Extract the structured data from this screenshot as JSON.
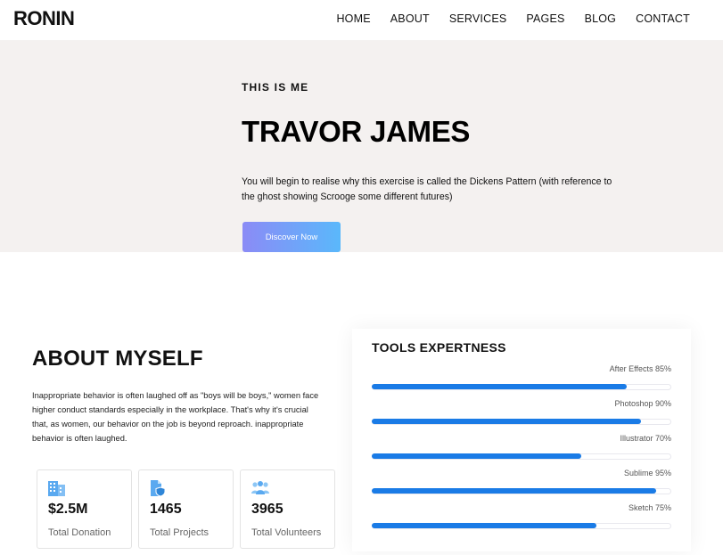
{
  "header": {
    "logo": "RONIN",
    "menu": [
      "HOME",
      "ABOUT",
      "SERVICES",
      "PAGES",
      "BLOG",
      "CONTACT"
    ]
  },
  "hero": {
    "kicker": "THIS IS ME",
    "title": "TRAVOR JAMES",
    "description": "You will begin to realise why this exercise is called the Dickens Pattern (with reference to the ghost showing Scrooge some different futures)",
    "button_label": "Discover Now"
  },
  "about": {
    "title": "ABOUT MYSELF",
    "text": "Inappropriate behavior is often laughed off as \"boys will be boys,\" women face higher conduct standards especially in the workplace. That's why it's crucial that, as women, our behavior on the job is beyond reproach. inappropriate behavior is often laughed.",
    "stats": [
      {
        "icon": "building-icon",
        "value": "$2.5M",
        "label": "Total Donation"
      },
      {
        "icon": "document-shield-icon",
        "value": "1465",
        "label": "Total Projects"
      },
      {
        "icon": "people-group-icon",
        "value": "3965",
        "label": "Total Volunteers"
      }
    ]
  },
  "tools": {
    "title": "TOOLS EXPERTNESS",
    "skills": [
      {
        "label": "After Effects 85%",
        "percent": 85
      },
      {
        "label": "Photoshop 90%",
        "percent": 90
      },
      {
        "label": "Illustrator 70%",
        "percent": 70
      },
      {
        "label": "Sublime 95%",
        "percent": 95
      },
      {
        "label": "Sketch 75%",
        "percent": 75
      }
    ]
  },
  "colors": {
    "accent": "#1a7be6",
    "icon": "#5aa9f0",
    "hero_bg": "#f4f1f0",
    "button_start": "#8b8bf6",
    "button_end": "#5ab8fb"
  }
}
